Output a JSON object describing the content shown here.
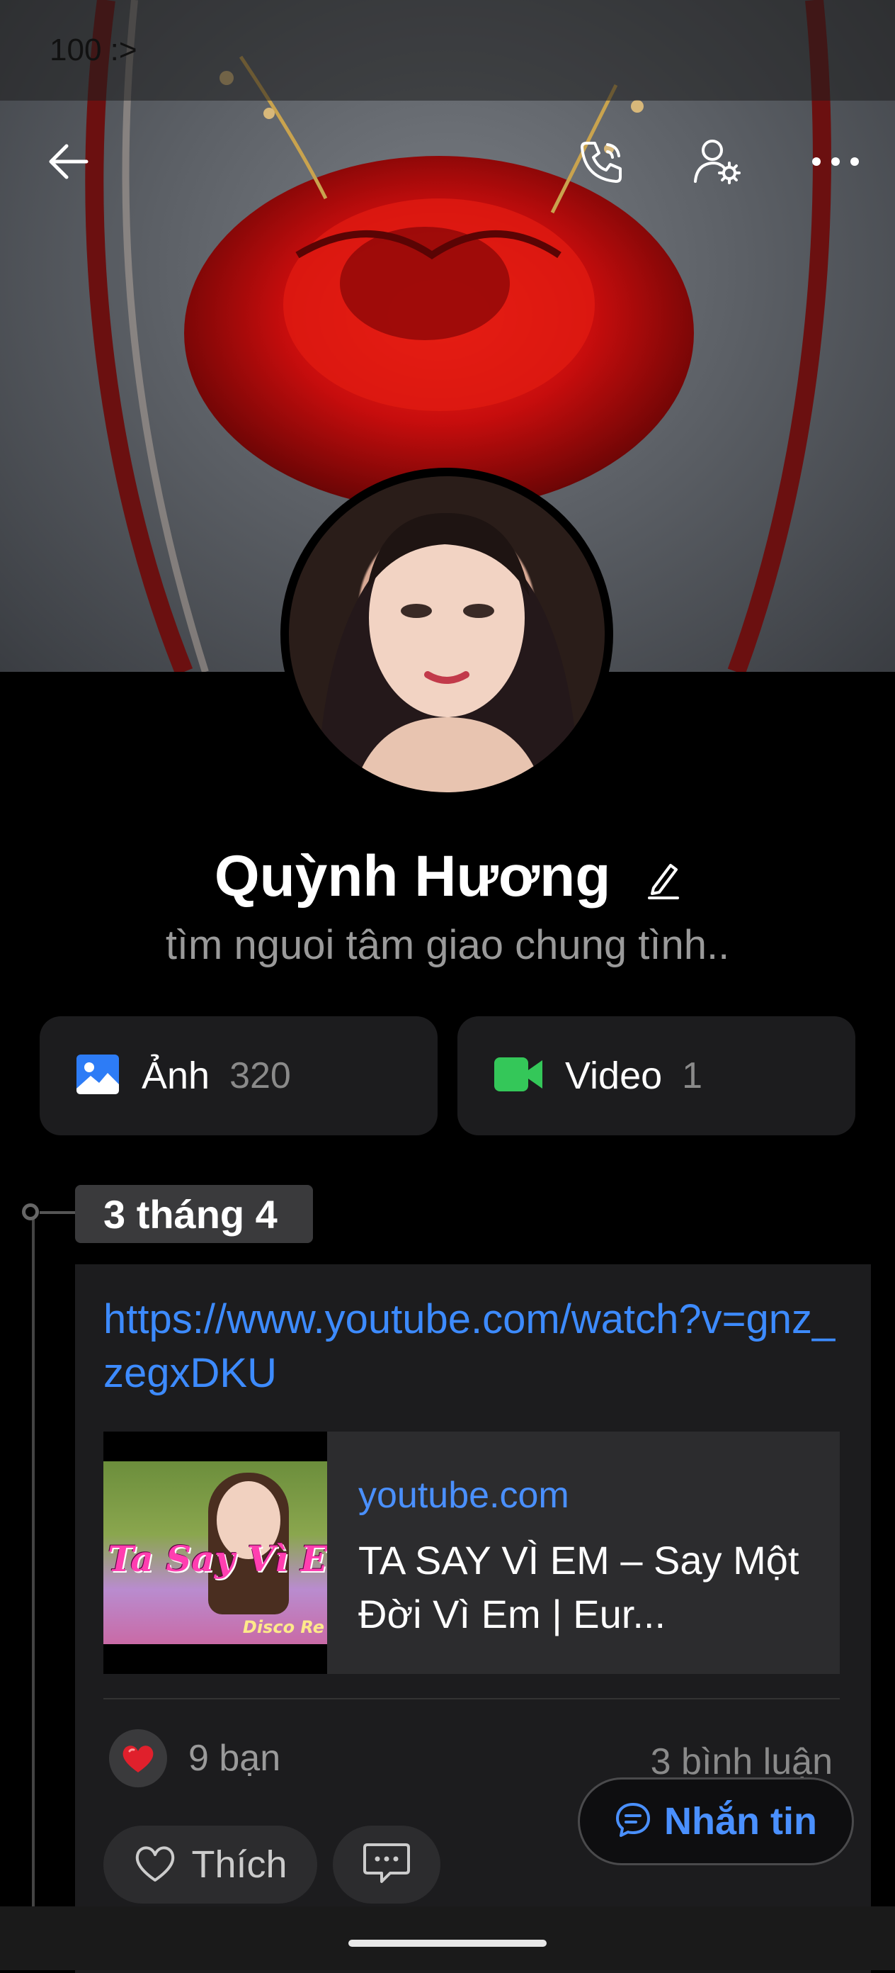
{
  "status_bar": {
    "text": "100 :>"
  },
  "header": {
    "icons": [
      "back-arrow-icon",
      "phone-icon",
      "user-settings-icon",
      "more-icon"
    ]
  },
  "profile": {
    "name": "Quỳnh Hương",
    "bio": "tìm nguoi tâm giao chung tình.."
  },
  "media": {
    "photos": {
      "label": "Ảnh",
      "count": "320",
      "icon": "image-icon",
      "color": "#2d7cf6"
    },
    "videos": {
      "label": "Video",
      "count": "1",
      "icon": "video-camera-icon",
      "color": "#34c759"
    }
  },
  "timeline": {
    "date": "3 tháng 4",
    "post": {
      "link": "https://www.youtube.com/watch?v=gnz_zegxDKU",
      "preview": {
        "thumbnail_title": "Ta Say Vì Em",
        "thumbnail_subtitle": "Disco Re",
        "domain": "youtube.com",
        "title": "TA SAY VÌ EM – Say Một Đời Vì Em | Eur..."
      },
      "reactions": {
        "count": "9 bạn",
        "icon": "heart-icon",
        "color": "#e0202c"
      },
      "comments": "3 bình luận",
      "like_label": "Thích",
      "more_dots": "···"
    }
  },
  "floating": {
    "message_label": "Nhắn tin"
  },
  "colors": {
    "accent": "#3d8bff",
    "background": "#000000",
    "card": "#1c1c1e"
  }
}
